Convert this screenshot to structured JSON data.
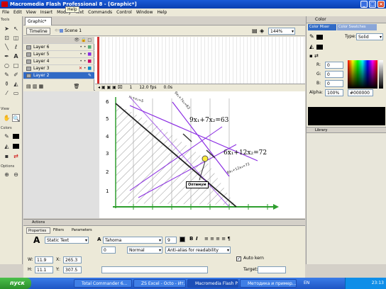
{
  "window": {
    "title": "Macromedia Flash Professional 8 - [Graphic*]",
    "tooltip": "Help"
  },
  "menu": [
    "File",
    "Edit",
    "View",
    "Insert",
    "Modify",
    "Text",
    "Commands",
    "Control",
    "Window",
    "Help"
  ],
  "tools": {
    "tools_label": "Tools",
    "view_label": "View",
    "colors_label": "Colors",
    "options_label": "Options"
  },
  "document": {
    "tab": "Graphic*",
    "timeline_button": "Timeline",
    "scene": "Scene 1",
    "zoom": "144%"
  },
  "timeline": {
    "layers": [
      {
        "name": "Layer 6"
      },
      {
        "name": "Layer 5"
      },
      {
        "name": "Layer 4"
      },
      {
        "name": "Layer 3"
      },
      {
        "name": "Layer 2"
      }
    ],
    "status": {
      "frame": "1",
      "fps": "12.0 fps",
      "time": "0.0s"
    }
  },
  "stage": {
    "eq1": "9x₁+7x₂=63",
    "eq2": "6x₁+12x₂=72",
    "optimum_label": "Оптимум",
    "line_label_a": "6x₁+12x₂=72",
    "line_label_b": "9x₁+7x₂=63",
    "line_label_c": "x₁+x₂=5",
    "y_ticks": [
      "1",
      "2",
      "3",
      "4",
      "5",
      "6"
    ]
  },
  "right_panel": {
    "color_tab": "Color",
    "mixer_tab": "Color Mixer",
    "swatches_tab": "Color Swatches",
    "type_label": "Type:",
    "type_value": "Solid",
    "r_label": "R:",
    "r_value": "0",
    "g_label": "G:",
    "g_value": "0",
    "b_label": "B:",
    "b_value": "0",
    "alpha_label": "Alpha:",
    "alpha_value": "100%",
    "hex_value": "#000000",
    "library_label": "Library"
  },
  "properties": {
    "actions_label": "Actions",
    "tabs": [
      "Properties",
      "Filters",
      "Parameters"
    ],
    "text_type": "Static Text",
    "font": "Tahoma",
    "font_size": "9",
    "spacing": "0",
    "position": "Normal",
    "antialias": "Anti-alias for readability",
    "w_label": "W:",
    "w_value": "11.9",
    "x_label": "X:",
    "x_value": "265.3",
    "h_label": "H:",
    "h_value": "11.1",
    "y_label": "Y:",
    "y_value": "307.5",
    "autokern": "Auto kern",
    "target_label": "Target:",
    "text_icon": "A"
  },
  "taskbar": {
    "start": "пуск",
    "tasks": [
      "Total Commander 6...",
      "ZS Excel - Octo - Ит...",
      "Macromedia Flash P...",
      "Методика и пример..."
    ],
    "lang": "EN",
    "clock": "23:13"
  },
  "colors": {
    "titlebar": "#0a3fb0",
    "accent": "#cc0000",
    "line_purple": "#8a2be2",
    "axis_green": "#2e9e2e",
    "hatch": "#888888"
  }
}
